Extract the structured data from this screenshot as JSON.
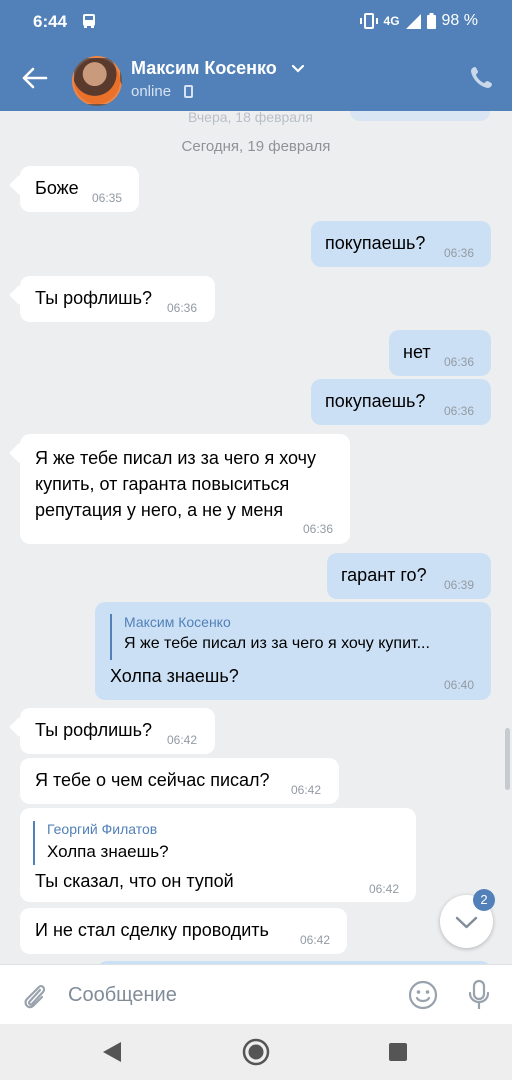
{
  "status": {
    "time": "6:44",
    "network": "4G",
    "battery": "98 %"
  },
  "header": {
    "contact_name": "Максим Косенко",
    "presence": "online",
    "icons": {
      "back": "arrow-left-icon",
      "call": "phone-icon",
      "expand": "chevron-down-icon"
    }
  },
  "chat": {
    "faded_date": "Вчера, 18 февраля",
    "date_separator": "Сегодня, 19 февраля",
    "messages": [
      {
        "dir": "in",
        "text": "Боже",
        "time": "06:35"
      },
      {
        "dir": "out",
        "text": "покупаешь?",
        "time": "06:36"
      },
      {
        "dir": "in",
        "text": "Ты рофлишь?",
        "time": "06:36"
      },
      {
        "dir": "out",
        "text": "нет",
        "time": "06:36"
      },
      {
        "dir": "out",
        "text": "покупаешь?",
        "time": "06:36"
      },
      {
        "dir": "in",
        "lines": [
          "Я же тебе писал из за чего я хочу",
          "купить, от гаранта повыситься",
          "репутация у него, а не у меня"
        ],
        "time": "06:36"
      },
      {
        "dir": "out",
        "text": "гарант го?",
        "time": "06:39"
      },
      {
        "dir": "out",
        "reply_name": "Максим Косенко",
        "reply_text": "Я же тебе писал из за чего я хочу купит...",
        "text": "Холпа знаешь?",
        "time": "06:40"
      },
      {
        "dir": "in",
        "text": "Ты рофлишь?",
        "time": "06:42"
      },
      {
        "dir": "in",
        "text": "Я тебе о чем сейчас писал?",
        "time": "06:42"
      },
      {
        "dir": "in",
        "reply_name": "Георгий Филатов",
        "reply_text": "Холпа знаешь?",
        "text": "Ты сказал, что он тупой",
        "time": "06:42"
      },
      {
        "dir": "in",
        "text": "И не стал сделку проводить",
        "time": "06:42"
      }
    ],
    "unread_badge": "2"
  },
  "composer": {
    "placeholder": "Сообщение",
    "icons": {
      "attach": "paperclip-icon",
      "emoji": "smile-icon",
      "voice": "microphone-icon"
    }
  },
  "colors": {
    "accent": "#5181b8",
    "outgoing": "#cce0f5",
    "incoming": "#ffffff",
    "background": "#edeef0"
  }
}
